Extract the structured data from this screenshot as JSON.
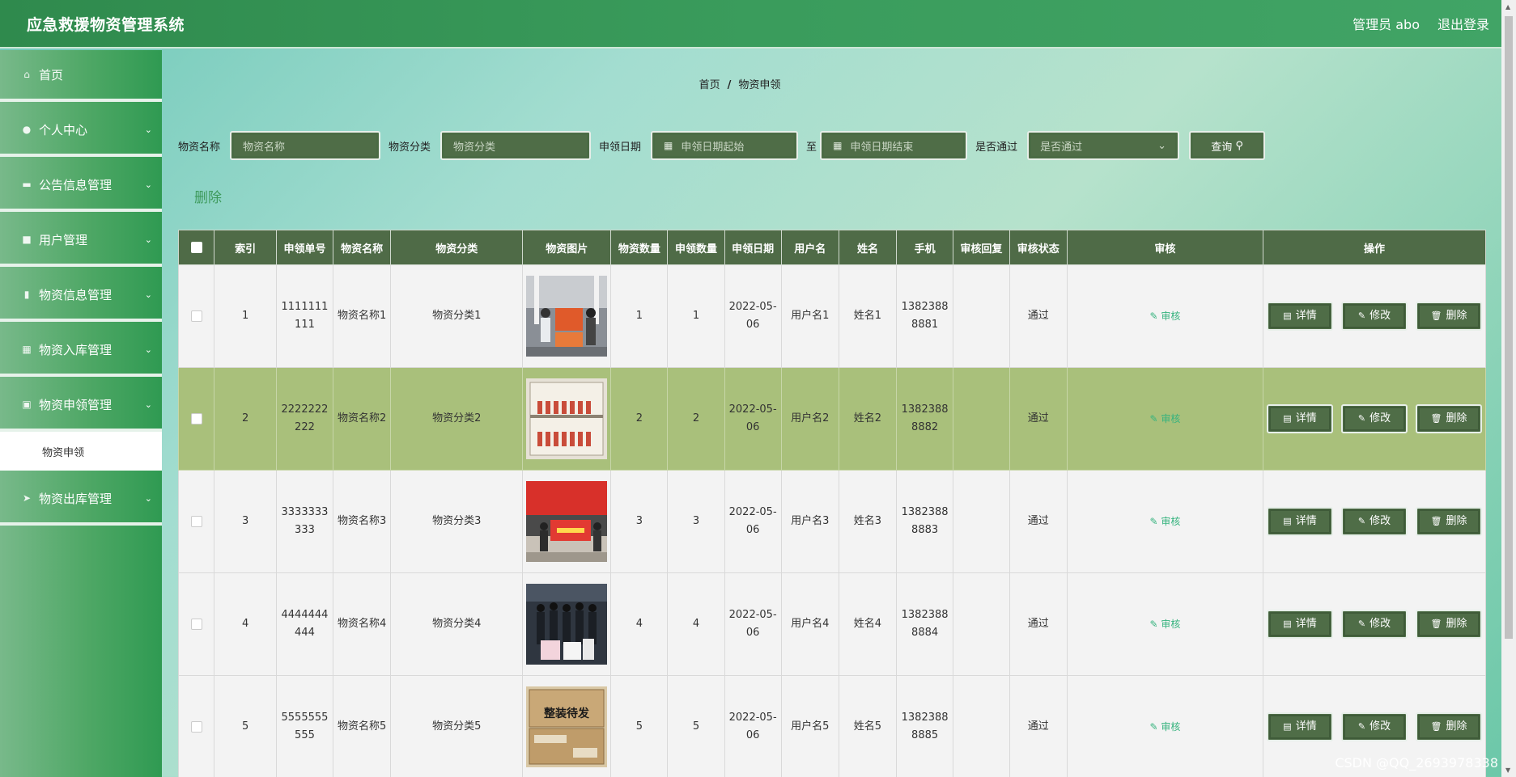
{
  "header": {
    "title": "应急救援物资管理系统",
    "admin": "管理员 abo",
    "logout": "退出登录"
  },
  "sidebar": {
    "items": [
      {
        "label": "首页",
        "icon": "home-icon",
        "glyph": "⌂",
        "chev": ""
      },
      {
        "label": "个人中心",
        "icon": "user-icon",
        "glyph": "●",
        "chev": "⌄"
      },
      {
        "label": "公告信息管理",
        "icon": "notice-icon",
        "glyph": "▬",
        "chev": "⌄"
      },
      {
        "label": "用户管理",
        "icon": "chat-icon",
        "glyph": "■",
        "chev": "⌄"
      },
      {
        "label": "物资信息管理",
        "icon": "chart-icon",
        "glyph": "▮",
        "chev": "⌄"
      },
      {
        "label": "物资入库管理",
        "icon": "grid-icon",
        "glyph": "▦",
        "chev": "⌄"
      },
      {
        "label": "物资申领管理",
        "icon": "clipboard-icon",
        "glyph": "▣",
        "chev": "⌄"
      }
    ],
    "submenu": "物资申领",
    "last_item": {
      "label": "物资出库管理",
      "icon": "send-icon",
      "glyph": "➤",
      "chev": "⌄"
    }
  },
  "breadcrumb": {
    "home": "首页",
    "sep": "/",
    "current": "物资申领"
  },
  "search": {
    "name_label": "物资名称",
    "name_placeholder": "物资名称",
    "cat_label": "物资分类",
    "cat_placeholder": "物资分类",
    "date_label": "申领日期",
    "date_start": "申领日期起始",
    "to": "至",
    "date_end": "申领日期结束",
    "pass_label": "是否通过",
    "pass_placeholder": "是否通过",
    "query": "查询"
  },
  "delete_label": "删除",
  "table": {
    "headers": [
      "索引",
      "申领单号",
      "物资名称",
      "物资分类",
      "物资图片",
      "物资数量",
      "申领数量",
      "申领日期",
      "用户名",
      "姓名",
      "手机",
      "审核回复",
      "审核状态",
      "审核",
      "操作"
    ],
    "audit_label": "审核",
    "btn_detail": "详情",
    "btn_edit": "修改",
    "btn_delete": "删除",
    "rows": [
      {
        "idx": "1",
        "no": "1111111111",
        "name": "物资名称1",
        "cat": "物资分类1",
        "qty": "1",
        "apply": "1",
        "date": "2022-05-06",
        "user": "用户名1",
        "real": "姓名1",
        "phone": "13823888881",
        "reply": "",
        "status": "通过"
      },
      {
        "idx": "2",
        "no": "2222222222",
        "name": "物资名称2",
        "cat": "物资分类2",
        "qty": "2",
        "apply": "2",
        "date": "2022-05-06",
        "user": "用户名2",
        "real": "姓名2",
        "phone": "13823888882",
        "reply": "",
        "status": "通过"
      },
      {
        "idx": "3",
        "no": "3333333333",
        "name": "物资名称3",
        "cat": "物资分类3",
        "qty": "3",
        "apply": "3",
        "date": "2022-05-06",
        "user": "用户名3",
        "real": "姓名3",
        "phone": "13823888883",
        "reply": "",
        "status": "通过"
      },
      {
        "idx": "4",
        "no": "4444444444",
        "name": "物资名称4",
        "cat": "物资分类4",
        "qty": "4",
        "apply": "4",
        "date": "2022-05-06",
        "user": "用户名4",
        "real": "姓名4",
        "phone": "13823888884",
        "reply": "",
        "status": "通过"
      },
      {
        "idx": "5",
        "no": "5555555555",
        "name": "物资名称5",
        "cat": "物资分类5",
        "qty": "5",
        "apply": "5",
        "date": "2022-05-06",
        "user": "用户名5",
        "real": "姓名5",
        "phone": "13823888885",
        "reply": "",
        "status": "通过"
      }
    ]
  },
  "watermark": "CSDN @QQ_2693978338"
}
